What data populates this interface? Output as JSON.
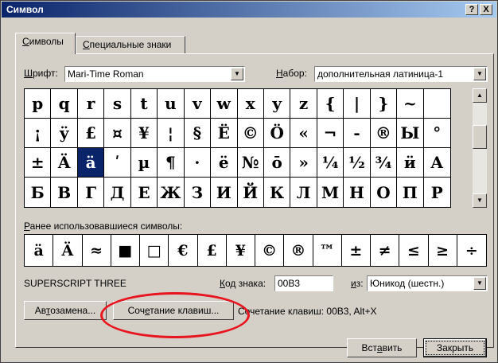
{
  "window": {
    "title": "Символ",
    "help_label": "?",
    "close_label": "X"
  },
  "tabs": [
    {
      "pre": "",
      "key": "С",
      "post": "имволы"
    },
    {
      "pre": "",
      "key": "С",
      "post": "пециальные знаки"
    }
  ],
  "font": {
    "label_key": "Ш",
    "label_rest": "рифт:",
    "value": "Mari-Time Roman"
  },
  "subset": {
    "label_key": "Н",
    "label_rest": "абор:",
    "value": "дополнительная латиница-1"
  },
  "grid": {
    "rows": [
      [
        "p",
        "q",
        "r",
        "s",
        "t",
        "u",
        "v",
        "w",
        "x",
        "y",
        "z",
        "{",
        "|",
        "}",
        "~",
        ""
      ],
      [
        "¡",
        "ÿ",
        "£",
        "¤",
        "¥",
        "¦",
        "§",
        "Ë",
        "©",
        "Ö",
        "«",
        "¬",
        "-",
        "®",
        "Ы",
        "°"
      ],
      [
        "±",
        "Ä",
        "ä",
        "ʹ",
        "µ",
        "¶",
        "·",
        "ë",
        "№",
        "ō",
        "»",
        "¼",
        "½",
        "¾",
        "ӥ",
        "А"
      ],
      [
        "Б",
        "В",
        "Г",
        "Д",
        "Е",
        "Ж",
        "З",
        "И",
        "Й",
        "К",
        "Л",
        "М",
        "Н",
        "О",
        "П",
        "Р"
      ]
    ],
    "selected": "ä"
  },
  "recent": {
    "label_key": "Р",
    "label_rest": "анее использовавшиеся символы:",
    "symbols": [
      "ä",
      "Ä",
      "≈",
      "■",
      "□",
      "€",
      "£",
      "¥",
      "©",
      "®",
      "™",
      "±",
      "≠",
      "≤",
      "≥",
      "÷"
    ]
  },
  "char_name": "SUPERSCRIPT THREE",
  "code": {
    "label_key": "К",
    "label_rest": "од знака:",
    "value": "00B3"
  },
  "from": {
    "label_key": "и",
    "label_rest": "з:",
    "value": "Юникод (шестн.)"
  },
  "buttons": {
    "autocorrect_pre": "Ав",
    "autocorrect_key": "т",
    "autocorrect_post": "озамена...",
    "shortcut_pre": "Соч",
    "shortcut_key": "е",
    "shortcut_post": "тание клавиш...",
    "insert_pre": "Вст",
    "insert_key": "а",
    "insert_post": "вить",
    "close_label": "Закрыть"
  },
  "shortcut_info": "Сочетание клавиш: 00B3, Alt+X",
  "annotation_color": "#e8141e",
  "icons": {
    "combo_arrow": "triangle-down",
    "scroll_up": "triangle-up",
    "scroll_down": "triangle-down"
  }
}
